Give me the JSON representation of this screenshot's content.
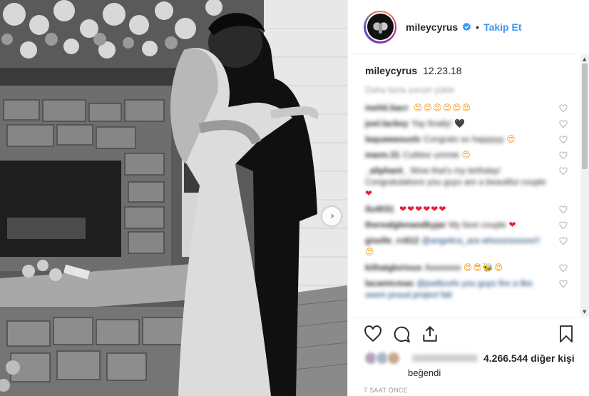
{
  "post": {
    "username": "mileycyrus",
    "follow_label": "Takip Et",
    "dot": "•",
    "caption": {
      "username": "mileycyrus",
      "text": "12.23.18"
    },
    "load_more": "Daha fazla yorum yükle",
    "comments": [
      {
        "user": "mehti.bacr",
        "text": "",
        "emoji": "😍😍😍😍😍😍",
        "emoji_color": "orange"
      },
      {
        "user": "joel.lackey",
        "text": "Yay finally!",
        "emoji": "🖤",
        "emoji_color": "dark"
      },
      {
        "user": "laquawasuolz",
        "text": "Congrats so happyyy",
        "emoji": "😍",
        "emoji_color": "orange"
      },
      {
        "user": "mann.31",
        "text": "Cutiiiee ummie",
        "emoji": "😍",
        "emoji_color": "orange"
      },
      {
        "user": "_aliphant_",
        "text": "Wow that's my birthday! Congratulations you guys are a beautiful couple",
        "emoji": "❤",
        "emoji_color": "red"
      },
      {
        "user": "ilu4031",
        "text": "",
        "emoji": "❤❤❤❤❤❤",
        "emoji_color": "red"
      },
      {
        "user": "therealglenandkyjar",
        "text": "My fave couple",
        "emoji": "❤",
        "emoji_color": "red"
      },
      {
        "user": "giselle_rc612",
        "text": "@angelica_ara whoozoooooo!!",
        "emoji": "😍",
        "emoji_color": "orange"
      },
      {
        "user": "kithatglorious",
        "text": "Awwwww",
        "emoji": "😍😎🐝😍",
        "emoji_color": "orange"
      },
      {
        "user": "lacamicmas",
        "text": "@joelbuvfo you guys fire a like seem proud project fall",
        "emoji": "",
        "emoji_color": "none"
      }
    ],
    "likes_count": "4.266.544 diğer kişi",
    "liked_label": "beğendi",
    "time_ago": "7 SAAT ÖNCE",
    "colors": {
      "accent": "#3897f0",
      "verified": "#3897f0"
    }
  }
}
